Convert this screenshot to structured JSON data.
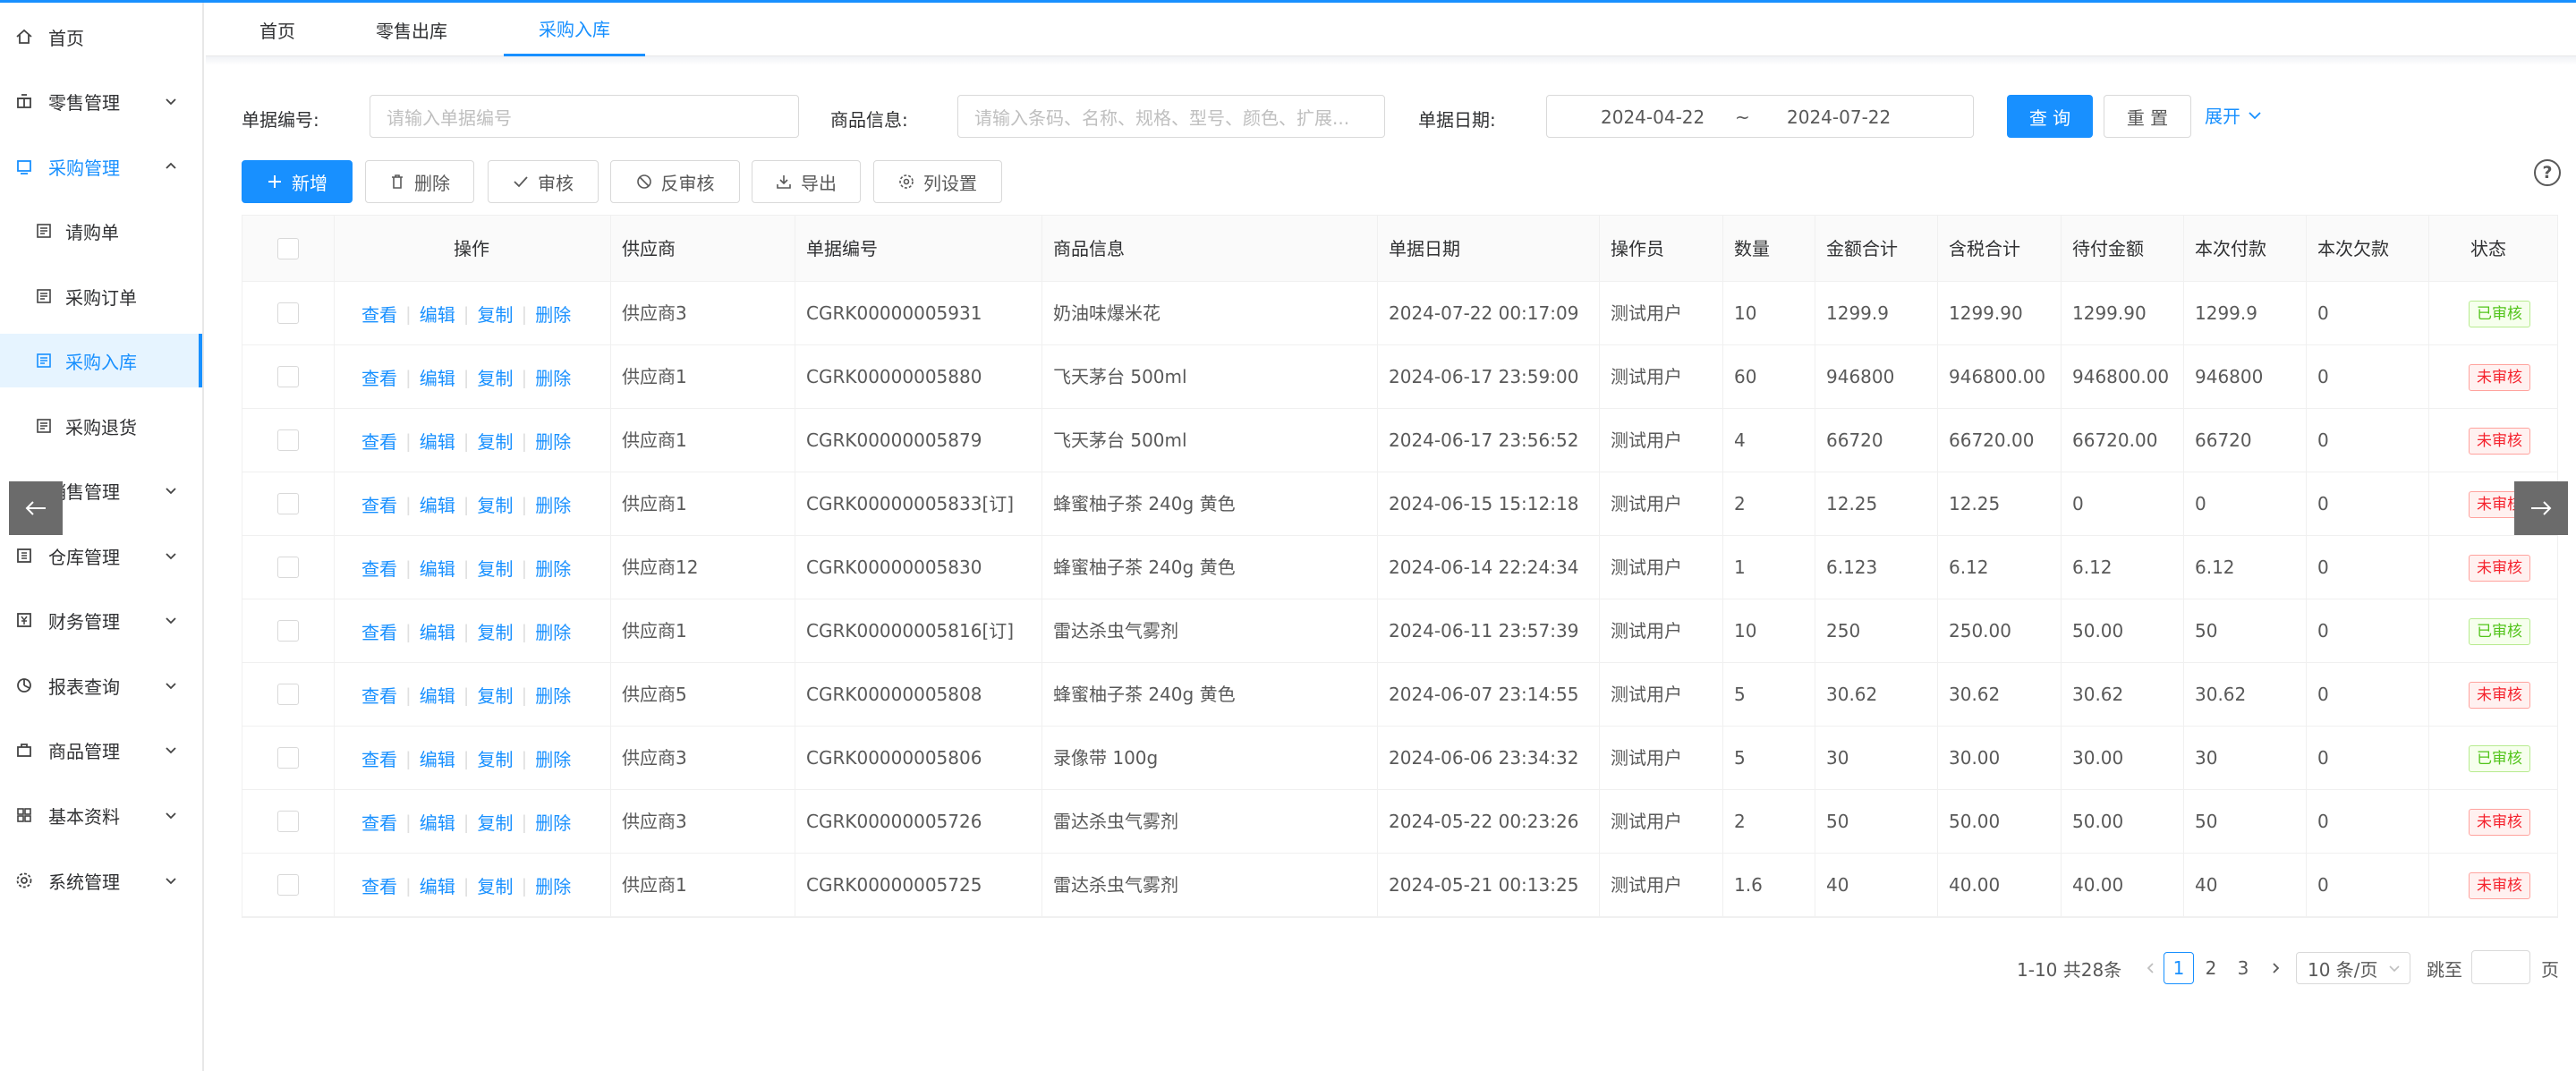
{
  "sidebar": {
    "items": [
      {
        "label": "首页",
        "icon": "home-icon"
      },
      {
        "label": "零售管理",
        "icon": "shop-icon"
      },
      {
        "label": "采购管理",
        "icon": "purchase-icon"
      },
      {
        "label": "请购单",
        "icon": "doc-icon"
      },
      {
        "label": "采购订单",
        "icon": "doc-icon"
      },
      {
        "label": "采购入库",
        "icon": "doc-icon"
      },
      {
        "label": "采购退货",
        "icon": "doc-icon"
      },
      {
        "label": "销售管理",
        "icon": "cart-icon"
      },
      {
        "label": "仓库管理",
        "icon": "warehouse-icon"
      },
      {
        "label": "财务管理",
        "icon": "finance-icon"
      },
      {
        "label": "报表查询",
        "icon": "chart-icon"
      },
      {
        "label": "商品管理",
        "icon": "goods-icon"
      },
      {
        "label": "基本资料",
        "icon": "grid-icon"
      },
      {
        "label": "系统管理",
        "icon": "settings-icon"
      }
    ]
  },
  "tabs": [
    {
      "label": "首页"
    },
    {
      "label": "零售出库"
    },
    {
      "label": "采购入库"
    }
  ],
  "search": {
    "bill_no_label": "单据编号:",
    "bill_no_placeholder": "请输入单据编号",
    "goods_label": "商品信息:",
    "goods_placeholder": "请输入条码、名称、规格、型号、颜色、扩展...",
    "date_label": "单据日期:",
    "date_start": "2024-04-22",
    "date_sep": "~",
    "date_end": "2024-07-22",
    "query_label": "查 询",
    "reset_label": "重 置",
    "expand_label": "展开"
  },
  "toolbar": {
    "add_label": "新增",
    "delete_label": "删除",
    "audit_label": "审核",
    "unaudit_label": "反审核",
    "export_label": "导出",
    "columns_label": "列设置",
    "help_label": "?"
  },
  "table": {
    "headers": {
      "ops": "操作",
      "supplier": "供应商",
      "bill_no": "单据编号",
      "goods": "商品信息",
      "date": "单据日期",
      "operator": "操作员",
      "qty": "数量",
      "amount": "金额合计",
      "tax_total": "含税合计",
      "pending": "待付金额",
      "paid": "本次付款",
      "debt": "本次欠款",
      "status": "状态"
    },
    "op_labels": {
      "view": "查看",
      "edit": "编辑",
      "copy": "复制",
      "delete": "删除"
    },
    "rows": [
      {
        "supplier": "供应商3",
        "bill_no": "CGRK00000005931",
        "goods": "奶油味爆米花",
        "date": "2024-07-22 00:17:09",
        "operator": "测试用户",
        "qty": "10",
        "amount": "1299.9",
        "tax_total": "1299.90",
        "pending": "1299.90",
        "paid": "1299.9",
        "debt": "0",
        "status": "已审核",
        "status_type": "ok"
      },
      {
        "supplier": "供应商1",
        "bill_no": "CGRK00000005880",
        "goods": "飞天茅台 500ml",
        "date": "2024-06-17 23:59:00",
        "operator": "测试用户",
        "qty": "60",
        "amount": "946800",
        "tax_total": "946800.00",
        "pending": "946800.00",
        "paid": "946800",
        "debt": "0",
        "status": "未审核",
        "status_type": "no"
      },
      {
        "supplier": "供应商1",
        "bill_no": "CGRK00000005879",
        "goods": "飞天茅台 500ml",
        "date": "2024-06-17 23:56:52",
        "operator": "测试用户",
        "qty": "4",
        "amount": "66720",
        "tax_total": "66720.00",
        "pending": "66720.00",
        "paid": "66720",
        "debt": "0",
        "status": "未审核",
        "status_type": "no"
      },
      {
        "supplier": "供应商1",
        "bill_no": "CGRK00000005833[订]",
        "goods": "蜂蜜柚子茶 240g 黄色",
        "date": "2024-06-15 15:12:18",
        "operator": "测试用户",
        "qty": "2",
        "amount": "12.25",
        "tax_total": "12.25",
        "pending": "0",
        "paid": "0",
        "debt": "0",
        "status": "未审核",
        "status_type": "no"
      },
      {
        "supplier": "供应商12",
        "bill_no": "CGRK00000005830",
        "goods": "蜂蜜柚子茶 240g 黄色",
        "date": "2024-06-14 22:24:34",
        "operator": "测试用户",
        "qty": "1",
        "amount": "6.123",
        "tax_total": "6.12",
        "pending": "6.12",
        "paid": "6.12",
        "debt": "0",
        "status": "未审核",
        "status_type": "no"
      },
      {
        "supplier": "供应商1",
        "bill_no": "CGRK00000005816[订]",
        "goods": "雷达杀虫气雾剂",
        "date": "2024-06-11 23:57:39",
        "operator": "测试用户",
        "qty": "10",
        "amount": "250",
        "tax_total": "250.00",
        "pending": "50.00",
        "paid": "50",
        "debt": "0",
        "status": "已审核",
        "status_type": "ok"
      },
      {
        "supplier": "供应商5",
        "bill_no": "CGRK00000005808",
        "goods": "蜂蜜柚子茶 240g 黄色",
        "date": "2024-06-07 23:14:55",
        "operator": "测试用户",
        "qty": "5",
        "amount": "30.62",
        "tax_total": "30.62",
        "pending": "30.62",
        "paid": "30.62",
        "debt": "0",
        "status": "未审核",
        "status_type": "no"
      },
      {
        "supplier": "供应商3",
        "bill_no": "CGRK00000005806",
        "goods": "录像带 100g",
        "date": "2024-06-06 23:34:32",
        "operator": "测试用户",
        "qty": "5",
        "amount": "30",
        "tax_total": "30.00",
        "pending": "30.00",
        "paid": "30",
        "debt": "0",
        "status": "已审核",
        "status_type": "ok"
      },
      {
        "supplier": "供应商3",
        "bill_no": "CGRK00000005726",
        "goods": "雷达杀虫气雾剂",
        "date": "2024-05-22 00:23:26",
        "operator": "测试用户",
        "qty": "2",
        "amount": "50",
        "tax_total": "50.00",
        "pending": "50.00",
        "paid": "50",
        "debt": "0",
        "status": "未审核",
        "status_type": "no"
      },
      {
        "supplier": "供应商1",
        "bill_no": "CGRK00000005725",
        "goods": "雷达杀虫气雾剂",
        "date": "2024-05-21 00:13:25",
        "operator": "测试用户",
        "qty": "1.6",
        "amount": "40",
        "tax_total": "40.00",
        "pending": "40.00",
        "paid": "40",
        "debt": "0",
        "status": "未审核",
        "status_type": "no"
      }
    ]
  },
  "pagination": {
    "summary": "1-10 共28条",
    "pages": [
      "1",
      "2",
      "3"
    ],
    "current": "1",
    "page_size": "10 条/页",
    "jump_label": "跳至",
    "page_unit": "页"
  },
  "colors": {
    "accent": "#1890ff",
    "ok": "#52c41a",
    "no": "#f5222d"
  }
}
